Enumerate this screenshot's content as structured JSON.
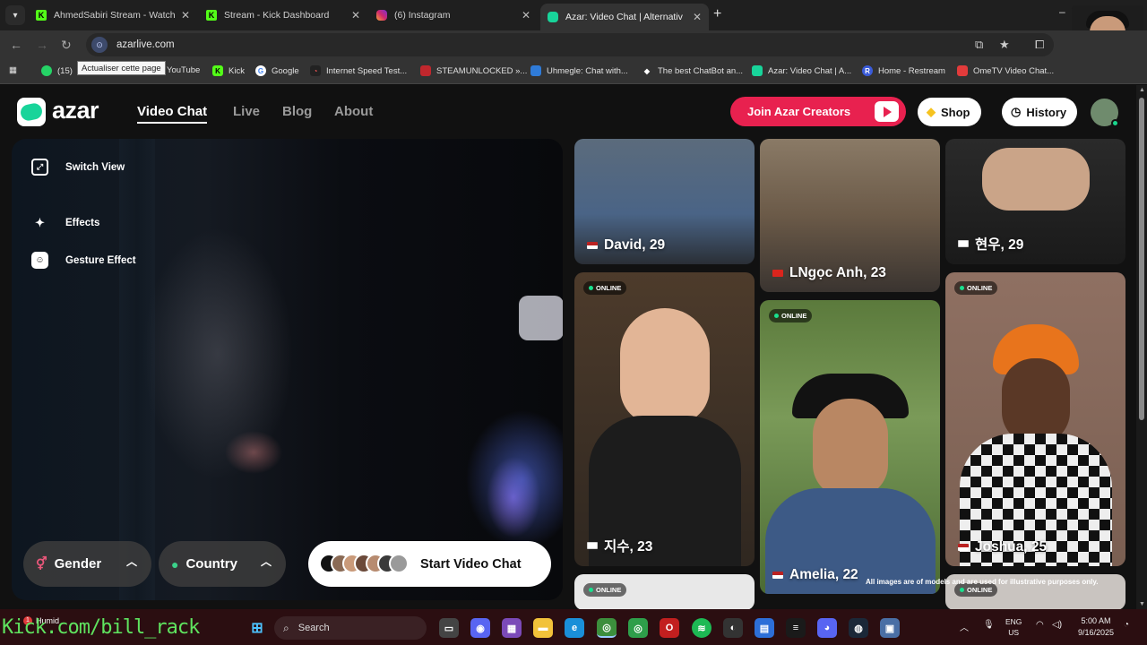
{
  "browser": {
    "tabs": [
      {
        "title": "AhmedSabiri Stream - Watch Li",
        "icon": "kick-icon",
        "active": false
      },
      {
        "title": "Stream - Kick Dashboard",
        "icon": "kick-icon",
        "active": false
      },
      {
        "title": "(6) Instagram",
        "icon": "instagram-icon",
        "active": false
      },
      {
        "title": "Azar: Video Chat | Alternativ",
        "icon": "azar-icon",
        "active": true
      }
    ],
    "url": "azarlive.com",
    "reload_tooltip": "Actualiser cette page",
    "bookmarks": [
      {
        "label": "(15)",
        "icon": "whatsapp-icon"
      },
      {
        "label": "YouTube",
        "icon": "youtube-icon"
      },
      {
        "label": "Kick",
        "icon": "kick-icon"
      },
      {
        "label": "Google",
        "icon": "google-icon"
      },
      {
        "label": "Internet Speed Test...",
        "icon": "speedtest-icon"
      },
      {
        "label": "STEAMUNLOCKED »...",
        "icon": "steamunlocked-icon"
      },
      {
        "label": "Uhmegle: Chat with...",
        "icon": "uhmegle-icon"
      },
      {
        "label": "The best ChatBot an...",
        "icon": "chatbot-icon"
      },
      {
        "label": "Azar: Video Chat | A...",
        "icon": "azar-icon"
      },
      {
        "label": "Home - Restream",
        "icon": "restream-icon"
      },
      {
        "label": "OmeTV Video Chat...",
        "icon": "ometv-icon"
      }
    ]
  },
  "site": {
    "logo_text": "azar",
    "nav": [
      "Video Chat",
      "Live",
      "Blog",
      "About"
    ],
    "creators_button": "Join Azar Creators",
    "shop_button": "Shop",
    "history_button": "History"
  },
  "camera": {
    "options": [
      "Switch View",
      "Effects",
      "Gesture Effect"
    ],
    "gender_filter": "Gender",
    "country_filter": "Country",
    "start_button": "Start Video Chat"
  },
  "cards": {
    "online_label": "ONLINE",
    "people": [
      {
        "name": "David, 29",
        "flag": "US"
      },
      {
        "name": "LNgọc Anh, 23",
        "flag": "VN"
      },
      {
        "name": "현우, 29",
        "flag": "KR"
      },
      {
        "name": "지수, 23",
        "flag": "KR"
      },
      {
        "name": "Amelia, 22",
        "flag": "US"
      },
      {
        "name": "Joshua, 25",
        "flag": "US"
      }
    ],
    "disclaimer": "All images are of models and are used for illustrative purposes only."
  },
  "taskbar": {
    "overlay_text": "Kick.com/bill_rack",
    "weather": "Humid",
    "weather_badge": "1",
    "search_placeholder": "Search",
    "lang_line1": "ENG",
    "lang_line2": "US",
    "time": "5:00 AM",
    "date": "9/16/2025"
  },
  "colors": {
    "azar_green": "#18d49a",
    "creators_red": "#e8214f",
    "online_green": "#19e08e",
    "page_bg": "#111111"
  }
}
